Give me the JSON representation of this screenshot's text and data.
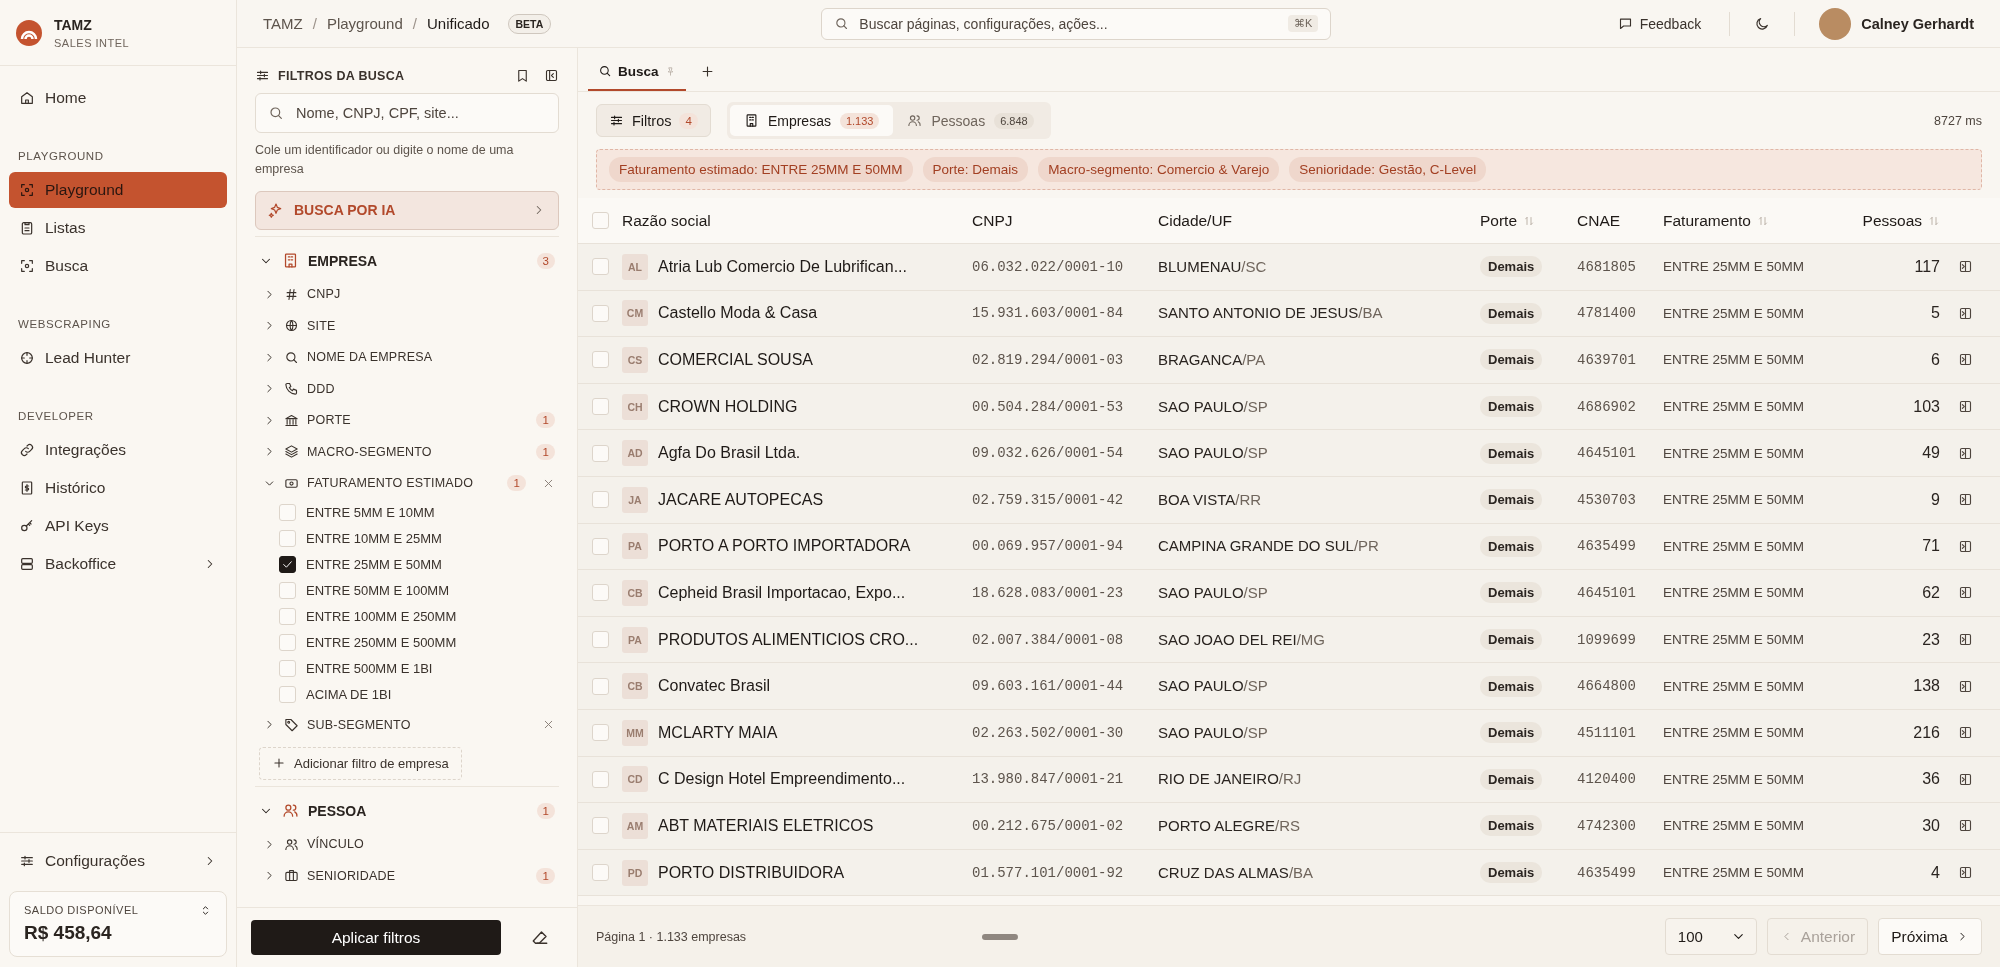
{
  "brand": {
    "name": "TAMZ",
    "subtitle": "SALES INTEL"
  },
  "nav_groups": [
    {
      "items": [
        {
          "label": "Home",
          "selected": false,
          "submenu": false
        }
      ]
    },
    {
      "heading": "PLAYGROUND",
      "items": [
        {
          "label": "Playground",
          "selected": true,
          "submenu": false
        },
        {
          "label": "Listas",
          "selected": false,
          "submenu": false
        },
        {
          "label": "Busca",
          "selected": false,
          "submenu": false
        }
      ]
    },
    {
      "heading": "WEBSCRAPING",
      "items": [
        {
          "label": "Lead Hunter",
          "selected": false,
          "submenu": false
        }
      ]
    },
    {
      "heading": "DEVELOPER",
      "items": [
        {
          "label": "Integrações",
          "selected": false,
          "submenu": false
        },
        {
          "label": "Histórico",
          "selected": false,
          "submenu": false
        },
        {
          "label": "API Keys",
          "selected": false,
          "submenu": false
        },
        {
          "label": "Backoffice",
          "selected": false,
          "submenu": true
        }
      ]
    }
  ],
  "settings": {
    "label": "Configurações"
  },
  "balance": {
    "label": "SALDO DISPONÍVEL",
    "value": "R$ 458,64"
  },
  "breadcrumb": [
    "TAMZ",
    "Playground",
    "Unificado"
  ],
  "breadcrumb_separator": "/",
  "badge": "BETA",
  "global_search": {
    "placeholder": "Buscar páginas, configurações, ações...",
    "shortcut": "⌘K"
  },
  "feedback": "Feedback",
  "user": {
    "name": "Calney Gerhardt"
  },
  "filters_panel": {
    "title": "FILTROS DA BUSCA",
    "search_placeholder": "Nome, CNPJ, CPF, site...",
    "hint": "Cole um identificador ou digite o nome de uma empresa",
    "ai_button": "BUSCA POR IA",
    "apply": "Aplicar filtros"
  },
  "filter_groups": [
    {
      "label": "EMPRESA",
      "count": "3",
      "expanded": true,
      "add_label": "Adicionar filtro de empresa",
      "filters": [
        {
          "label": "CNPJ",
          "expanded": false,
          "removable": false
        },
        {
          "label": "SITE",
          "expanded": false,
          "removable": false
        },
        {
          "label": "NOME DA EMPRESA",
          "expanded": false,
          "removable": false
        },
        {
          "label": "DDD",
          "expanded": false,
          "removable": false
        },
        {
          "label": "PORTE",
          "count": "1",
          "expanded": false,
          "removable": false
        },
        {
          "label": "MACRO-SEGMENTO",
          "count": "1",
          "expanded": false,
          "removable": false
        },
        {
          "label": "FATURAMENTO ESTIMADO",
          "count": "1",
          "expanded": true,
          "removable": true,
          "options": [
            {
              "label": "ENTRE 5MM E 10MM",
              "checked": false
            },
            {
              "label": "ENTRE 10MM E 25MM",
              "checked": false
            },
            {
              "label": "ENTRE 25MM E 50MM",
              "checked": true
            },
            {
              "label": "ENTRE 50MM E 100MM",
              "checked": false
            },
            {
              "label": "ENTRE 100MM E 250MM",
              "checked": false
            },
            {
              "label": "ENTRE 250MM E 500MM",
              "checked": false
            },
            {
              "label": "ENTRE 500MM E 1BI",
              "checked": false
            },
            {
              "label": "ACIMA DE 1BI",
              "checked": false
            }
          ]
        },
        {
          "label": "SUB-SEGMENTO",
          "expanded": false,
          "removable": true
        }
      ]
    },
    {
      "label": "PESSOA",
      "count": "1",
      "expanded": true,
      "filters": [
        {
          "label": "VÍNCULO",
          "expanded": false,
          "removable": false
        },
        {
          "label": "SENIORIDADE",
          "count": "1",
          "expanded": false,
          "removable": false
        }
      ]
    }
  ],
  "tabs": [
    {
      "label": "Busca",
      "selected": true
    }
  ],
  "filters_button": {
    "label": "Filtros",
    "count": "4"
  },
  "segments": [
    {
      "label": "Empresas",
      "count": "1.133",
      "selected": true
    },
    {
      "label": "Pessoas",
      "count": "6.848",
      "selected": false
    }
  ],
  "timing": "8727 ms",
  "chips": [
    "Faturamento estimado: ENTRE 25MM E 50MM",
    "Porte: Demais",
    "Macro-segmento: Comercio & Varejo",
    "Senioridade: Gestão, C-Level"
  ],
  "table": {
    "all_selected": false,
    "columns": [
      {
        "label": "Razão social",
        "sortable": false
      },
      {
        "label": "CNPJ",
        "sortable": false
      },
      {
        "label": "Cidade/UF",
        "sortable": false
      },
      {
        "label": "Porte",
        "sortable": true
      },
      {
        "label": "CNAE",
        "sortable": false
      },
      {
        "label": "Faturamento",
        "sortable": true
      },
      {
        "label": "Pessoas",
        "sortable": true
      }
    ],
    "rows": [
      {
        "initials": "AL",
        "name": "Atria Lub Comercio De Lubrifican...",
        "cnpj": "06.032.022/0001-10",
        "city": "BLUMENAU",
        "uf": "/SC",
        "porte": "Demais",
        "cnae": "4681805",
        "faturamento": "ENTRE 25MM E 50MM",
        "pessoas": "117",
        "selected": false
      },
      {
        "initials": "CM",
        "name": "Castello Moda & Casa",
        "cnpj": "15.931.603/0001-84",
        "city": "SANTO ANTONIO DE JESUS",
        "uf": "/BA",
        "porte": "Demais",
        "cnae": "4781400",
        "faturamento": "ENTRE 25MM E 50MM",
        "pessoas": "5",
        "selected": false
      },
      {
        "initials": "CS",
        "name": "COMERCIAL SOUSA",
        "cnpj": "02.819.294/0001-03",
        "city": "BRAGANCA",
        "uf": "/PA",
        "porte": "Demais",
        "cnae": "4639701",
        "faturamento": "ENTRE 25MM E 50MM",
        "pessoas": "6",
        "selected": false
      },
      {
        "initials": "CH",
        "name": "CROWN HOLDING",
        "cnpj": "00.504.284/0001-53",
        "city": "SAO PAULO",
        "uf": "/SP",
        "porte": "Demais",
        "cnae": "4686902",
        "faturamento": "ENTRE 25MM E 50MM",
        "pessoas": "103",
        "selected": false
      },
      {
        "initials": "AD",
        "name": "Agfa Do Brasil Ltda.",
        "cnpj": "09.032.626/0001-54",
        "city": "SAO PAULO",
        "uf": "/SP",
        "porte": "Demais",
        "cnae": "4645101",
        "faturamento": "ENTRE 25MM E 50MM",
        "pessoas": "49",
        "selected": false
      },
      {
        "initials": "JA",
        "name": "JACARE AUTOPECAS",
        "cnpj": "02.759.315/0001-42",
        "city": "BOA VISTA",
        "uf": "/RR",
        "porte": "Demais",
        "cnae": "4530703",
        "faturamento": "ENTRE 25MM E 50MM",
        "pessoas": "9",
        "selected": false
      },
      {
        "initials": "PA",
        "name": "PORTO A PORTO IMPORTADORA",
        "cnpj": "00.069.957/0001-94",
        "city": "CAMPINA GRANDE DO SUL",
        "uf": "/PR",
        "porte": "Demais",
        "cnae": "4635499",
        "faturamento": "ENTRE 25MM E 50MM",
        "pessoas": "71",
        "selected": false
      },
      {
        "initials": "CB",
        "name": "Cepheid Brasil Importacao, Expo...",
        "cnpj": "18.628.083/0001-23",
        "city": "SAO PAULO",
        "uf": "/SP",
        "porte": "Demais",
        "cnae": "4645101",
        "faturamento": "ENTRE 25MM E 50MM",
        "pessoas": "62",
        "selected": false
      },
      {
        "initials": "PA",
        "name": "PRODUTOS ALIMENTICIOS CRO...",
        "cnpj": "02.007.384/0001-08",
        "city": "SAO JOAO DEL REI",
        "uf": "/MG",
        "porte": "Demais",
        "cnae": "1099699",
        "faturamento": "ENTRE 25MM E 50MM",
        "pessoas": "23",
        "selected": false
      },
      {
        "initials": "CB",
        "name": "Convatec Brasil",
        "cnpj": "09.603.161/0001-44",
        "city": "SAO PAULO",
        "uf": "/SP",
        "porte": "Demais",
        "cnae": "4664800",
        "faturamento": "ENTRE 25MM E 50MM",
        "pessoas": "138",
        "selected": false
      },
      {
        "initials": "MM",
        "name": "MCLARTY MAIA",
        "cnpj": "02.263.502/0001-30",
        "city": "SAO PAULO",
        "uf": "/SP",
        "porte": "Demais",
        "cnae": "4511101",
        "faturamento": "ENTRE 25MM E 50MM",
        "pessoas": "216",
        "selected": false
      },
      {
        "initials": "CD",
        "name": "C Design Hotel Empreendimento...",
        "cnpj": "13.980.847/0001-21",
        "city": "RIO DE JANEIRO",
        "uf": "/RJ",
        "porte": "Demais",
        "cnae": "4120400",
        "faturamento": "ENTRE 25MM E 50MM",
        "pessoas": "36",
        "selected": false
      },
      {
        "initials": "AM",
        "name": "ABT MATERIAIS ELETRICOS",
        "cnpj": "00.212.675/0001-02",
        "city": "PORTO ALEGRE",
        "uf": "/RS",
        "porte": "Demais",
        "cnae": "4742300",
        "faturamento": "ENTRE 25MM E 50MM",
        "pessoas": "30",
        "selected": false
      },
      {
        "initials": "PD",
        "name": "PORTO DISTRIBUIDORA",
        "cnpj": "01.577.101/0001-92",
        "city": "CRUZ DAS ALMAS",
        "uf": "/BA",
        "porte": "Demais",
        "cnae": "4635499",
        "faturamento": "ENTRE 25MM E 50MM",
        "pessoas": "4",
        "selected": false
      }
    ]
  },
  "pagination": {
    "summary": "Página 1 · 1.133 empresas",
    "page_size": "100",
    "previous": {
      "label": "Anterior",
      "disabled": true
    },
    "next": {
      "label": "Próxima",
      "disabled": false
    }
  }
}
